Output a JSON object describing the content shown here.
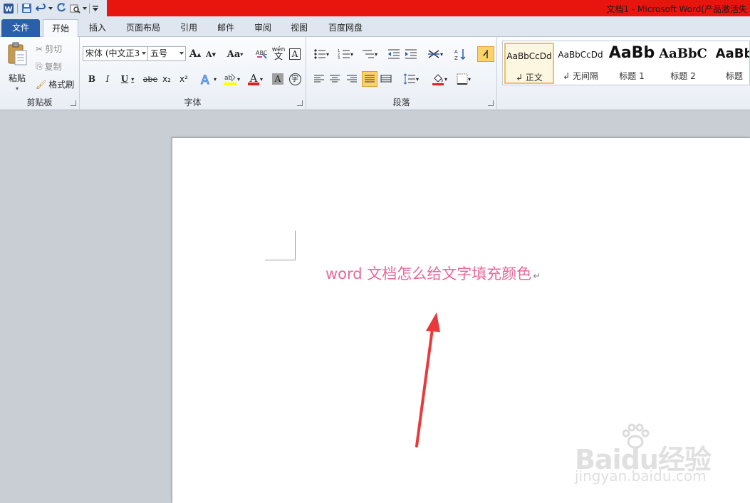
{
  "titlebar": {
    "title": "文档1 - Microsoft Word(产品激活失",
    "brand_color": "#e8150e"
  },
  "tabs": [
    {
      "label": "文件"
    },
    {
      "label": "开始"
    },
    {
      "label": "插入"
    },
    {
      "label": "页面布局"
    },
    {
      "label": "引用"
    },
    {
      "label": "邮件"
    },
    {
      "label": "审阅"
    },
    {
      "label": "视图"
    },
    {
      "label": "百度网盘"
    }
  ],
  "clipboard": {
    "group_label": "剪贴板",
    "paste": "粘贴",
    "cut": "剪切",
    "copy": "复制",
    "format_painter": "格式刷"
  },
  "font": {
    "group_label": "字体",
    "font_name": "宋体 (中文正3",
    "font_size": "五号",
    "grow": "A",
    "shrink": "A",
    "change_case": "Aa",
    "bold": "B",
    "italic": "I",
    "underline": "U",
    "strike": "abe",
    "subscript": "x₂",
    "superscript": "x²",
    "font_color": "A",
    "char_shade": "A",
    "enclose": "字",
    "phonetic": "wén"
  },
  "paragraph": {
    "group_label": "段落"
  },
  "styles": [
    {
      "sample": "AaBbCcDd",
      "name": "↲ 正文"
    },
    {
      "sample": "AaBbCcDd",
      "name": "↲ 无间隔"
    },
    {
      "sample": "AaBb",
      "name": "标题 1"
    },
    {
      "sample": "AaBbC",
      "name": "标题 2"
    },
    {
      "sample": "AaBb",
      "name": "标题"
    }
  ],
  "document": {
    "text": "word 文档怎么给文字填充颜色",
    "pilcrow": "↵",
    "text_color": "#e9679a"
  },
  "watermark": {
    "logo": "Baidu经验",
    "url": "jingyan.baidu.com"
  }
}
